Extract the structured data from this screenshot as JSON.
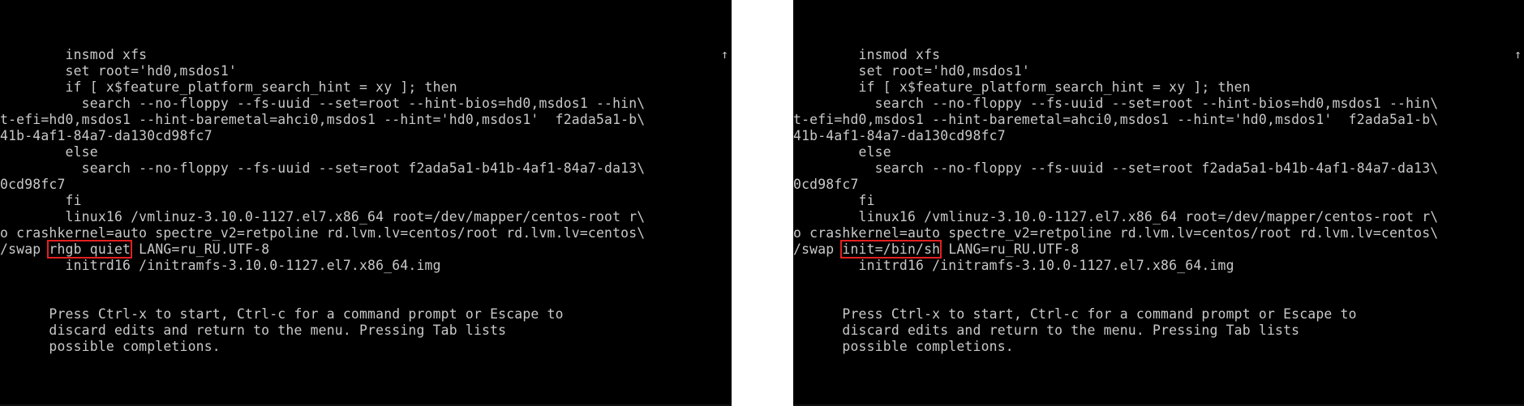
{
  "scroll_indicator": "↑",
  "left_panel": {
    "lines": [
      {
        "text": "        insmod xfs"
      },
      {
        "text": "        set root='hd0,msdos1'"
      },
      {
        "text": "        if [ x$feature_platform_search_hint = xy ]; then"
      },
      {
        "text": "          search --no-floppy --fs-uuid --set=root --hint-bios=hd0,msdos1 --hin\\"
      },
      {
        "text": "t-efi=hd0,msdos1 --hint-baremetal=ahci0,msdos1 --hint='hd0,msdos1'  f2ada5a1-b\\"
      },
      {
        "text": "41b-4af1-84a7-da130cd98fc7"
      },
      {
        "text": "        else"
      },
      {
        "text": "          search --no-floppy --fs-uuid --set=root f2ada5a1-b41b-4af1-84a7-da13\\"
      },
      {
        "text": "0cd98fc7"
      },
      {
        "text": "        fi"
      },
      {
        "text": "        linux16 /vmlinuz-3.10.0-1127.el7.x86_64 root=/dev/mapper/centos-root r\\"
      },
      {
        "text": "o crashkernel=auto spectre_v2=retpoline rd.lvm.lv=centos/root rd.lvm.lv=centos\\"
      },
      {
        "before": "/swap ",
        "highlight": "rhgb quiet",
        "after": " LANG=ru_RU.UTF-8"
      },
      {
        "text": "        initrd16 /initramfs-3.10.0-1127.el7.x86_64.img"
      }
    ]
  },
  "right_panel": {
    "lines": [
      {
        "text": "        insmod xfs"
      },
      {
        "text": "        set root='hd0,msdos1'"
      },
      {
        "text": "        if [ x$feature_platform_search_hint = xy ]; then"
      },
      {
        "text": "          search --no-floppy --fs-uuid --set=root --hint-bios=hd0,msdos1 --hin\\"
      },
      {
        "text": "t-efi=hd0,msdos1 --hint-baremetal=ahci0,msdos1 --hint='hd0,msdos1'  f2ada5a1-b\\"
      },
      {
        "text": "41b-4af1-84a7-da130cd98fc7"
      },
      {
        "text": "        else"
      },
      {
        "text": "          search --no-floppy --fs-uuid --set=root f2ada5a1-b41b-4af1-84a7-da13\\"
      },
      {
        "text": "0cd98fc7"
      },
      {
        "text": "        fi"
      },
      {
        "text": "        linux16 /vmlinuz-3.10.0-1127.el7.x86_64 root=/dev/mapper/centos-root r\\"
      },
      {
        "text": "o crashkernel=auto spectre_v2=retpoline rd.lvm.lv=centos/root rd.lvm.lv=centos\\"
      },
      {
        "before": "/swap ",
        "highlight": "init=/bin/sh",
        "after": " LANG=ru_RU.UTF-8"
      },
      {
        "text": "        initrd16 /initramfs-3.10.0-1127.el7.x86_64.img"
      }
    ]
  },
  "help": {
    "lines": [
      "      Press Ctrl-x to start, Ctrl-c for a command prompt or Escape to",
      "      discard edits and return to the menu. Pressing Tab lists",
      "      possible completions."
    ]
  },
  "colors": {
    "background": "#000000",
    "text": "#c9c9c9",
    "highlight_box": "#e32020",
    "gap": "#ffffff"
  }
}
